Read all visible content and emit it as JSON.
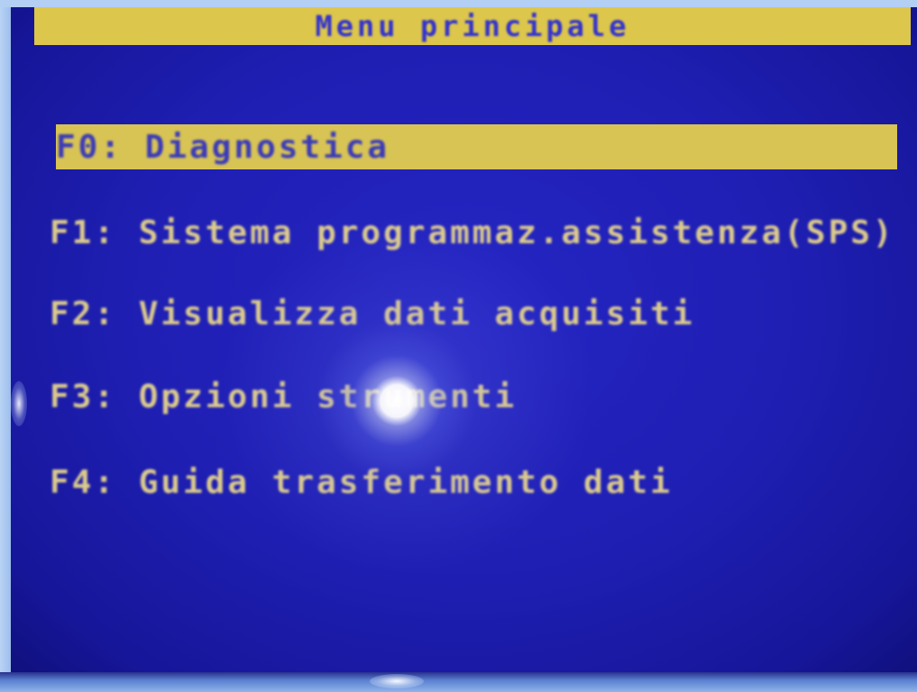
{
  "window": {
    "title": "Menu principale"
  },
  "menu": {
    "items": [
      {
        "text": "F0: Diagnostica",
        "selected": true
      },
      {
        "text": "F1: Sistema programmaz.assistenza(SPS)",
        "selected": false
      },
      {
        "text": "F2: Visualizza dati acquisiti",
        "selected": false
      },
      {
        "text": "F3: Opzioni strumenti",
        "selected": false
      },
      {
        "text": "F4: Guida trasferimento dati",
        "selected": false
      }
    ]
  },
  "colors": {
    "screen_background": "#1f1fb4",
    "title_bar": "#dcc64c",
    "highlight_bar": "#d8c455",
    "menu_text": "#dccb8c",
    "title_text": "#3434cc"
  }
}
